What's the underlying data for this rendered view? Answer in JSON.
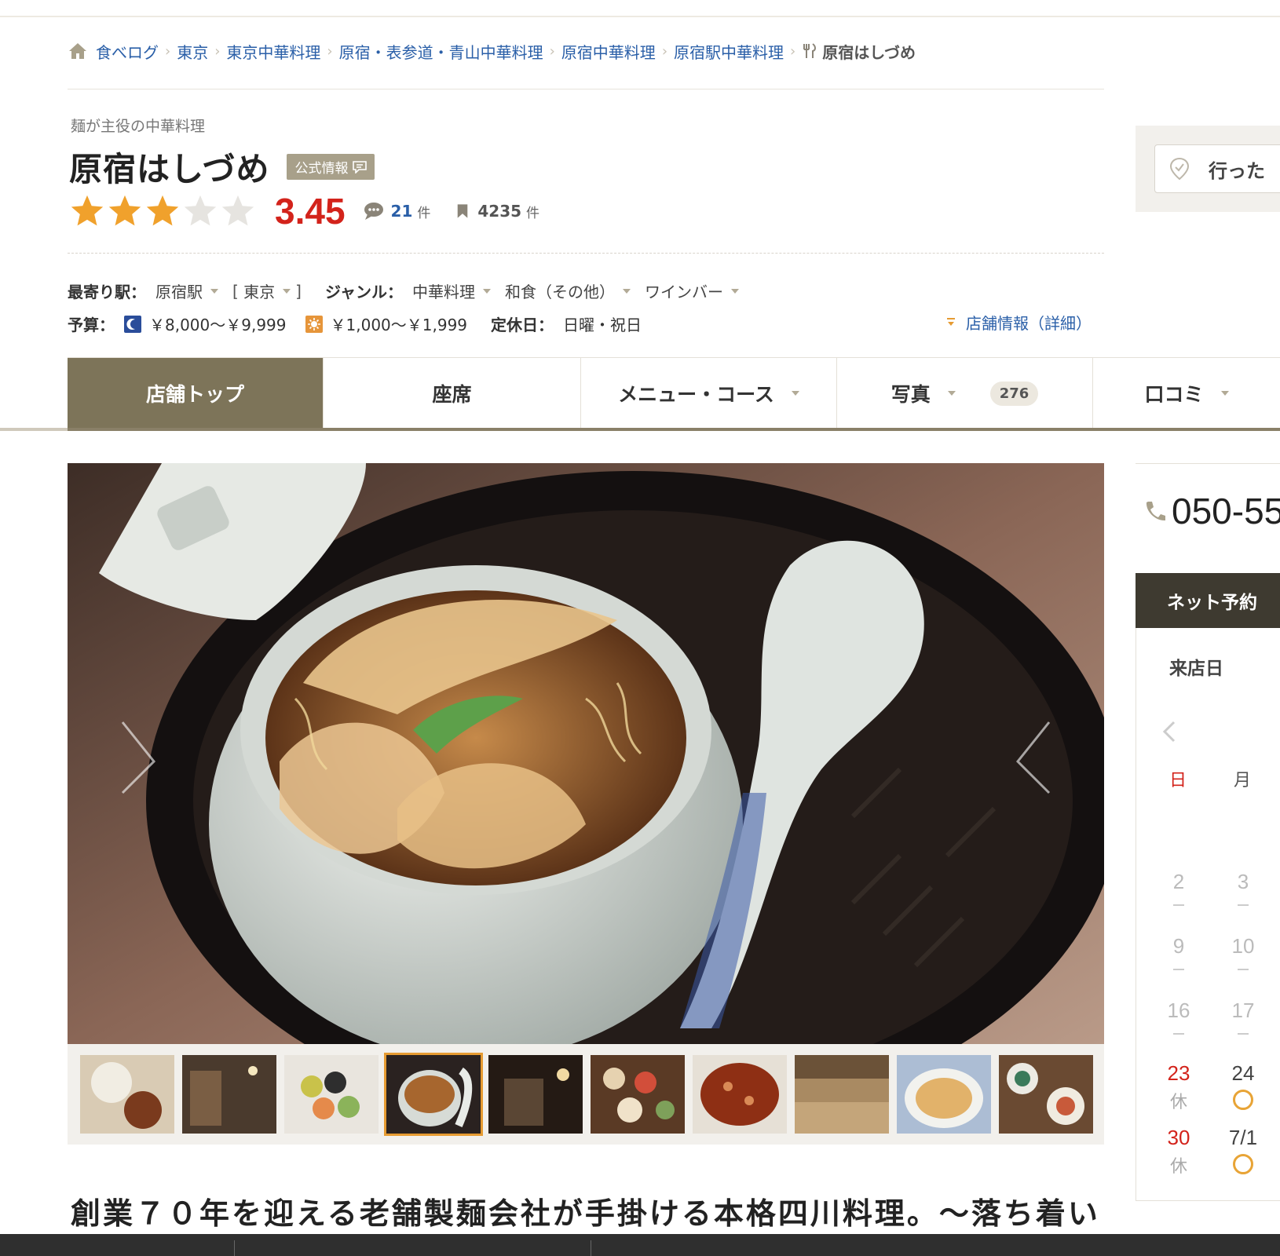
{
  "breadcrumb": {
    "items": [
      "食べログ",
      "東京",
      "東京中華料理",
      "原宿・表参道・青山中華料理",
      "原宿中華料理",
      "原宿駅中華料理"
    ],
    "current": "原宿はしづめ"
  },
  "header": {
    "catch_copy": "麺が主役の中華料理",
    "title": "原宿はしづめ",
    "official_badge": "公式情報",
    "rating": 3.45,
    "rating_label": "3.45",
    "reviews_count": "21",
    "reviews_unit": "件",
    "bookmarks_count": "4235",
    "bookmarks_unit": "件"
  },
  "info": {
    "station_label": "最寄り駅：",
    "station": "原宿駅",
    "area": "東京",
    "genre_label": "ジャンル：",
    "genres": [
      "中華料理",
      "和食（その他）",
      "ワインバー"
    ],
    "budget_label": "予算：",
    "budget_dinner": "￥8,000～￥9,999",
    "budget_lunch": "￥1,000～￥1,999",
    "holiday_label": "定休日：",
    "holiday": "日曜・祝日",
    "detail_link": "店舗情報（詳細）"
  },
  "tabs": [
    {
      "label": "店舗トップ",
      "active": true
    },
    {
      "label": "座席"
    },
    {
      "label": "メニュー・コース"
    },
    {
      "label": "写真",
      "badge": "276"
    },
    {
      "label": "口コミ"
    }
  ],
  "lead_text": "創業７０年を迎える老舗製麺会社が手掛ける本格四川料理。～落ち着い",
  "sidebar": {
    "went_label": "行った",
    "phone": "050-55",
    "reserve_title": "ネット予約",
    "visit_date_label": "来店日",
    "dow": [
      "日",
      "月"
    ],
    "rows": [
      [
        "2",
        "3"
      ],
      [
        "9",
        "10"
      ],
      [
        "16",
        "17"
      ],
      [
        "23",
        "24"
      ],
      [
        "30",
        "7/1"
      ]
    ],
    "closed_label": "休",
    "dash": "－"
  },
  "colors": {
    "accent": "#7d7459",
    "link": "#2a5fa8",
    "score": "#d3231b",
    "star": "#f0a12c",
    "sunday": "#d3231b",
    "available": "#e8a436"
  },
  "icons": [
    "home-icon",
    "fork-knife-icon",
    "speech-bubble-icon",
    "bookmark-icon",
    "moon-icon",
    "sun-icon",
    "map-pin-icon",
    "phone-icon",
    "chevron-left-icon"
  ]
}
